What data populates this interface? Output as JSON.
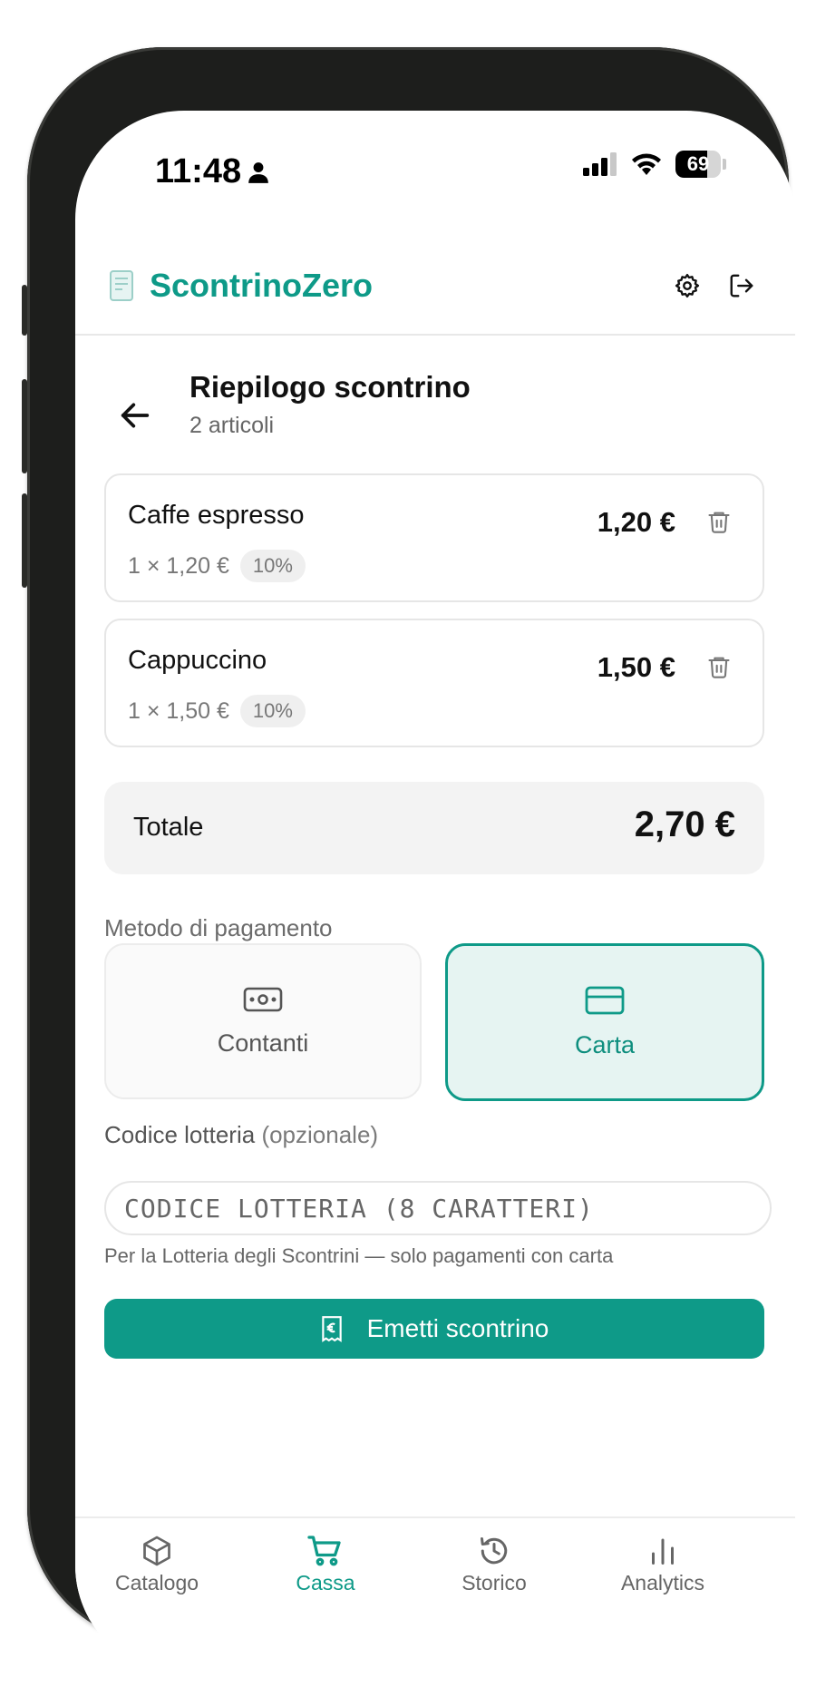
{
  "status_bar": {
    "time": "11:48",
    "battery": "69"
  },
  "header": {
    "app_name": "ScontrinoZero"
  },
  "page": {
    "title": "Riepilogo scontrino",
    "subtitle": "2 articoli"
  },
  "items": [
    {
      "name": "Caffe espresso",
      "qty_price": "1 × 1,20 €",
      "vat": "10%",
      "total": "1,20 €"
    },
    {
      "name": "Cappuccino",
      "qty_price": "1 × 1,50 €",
      "vat": "10%",
      "total": "1,50 €"
    }
  ],
  "total": {
    "label": "Totale",
    "value": "2,70 €"
  },
  "payment": {
    "label": "Metodo di pagamento",
    "options": [
      {
        "label": "Contanti",
        "selected": false
      },
      {
        "label": "Carta",
        "selected": true
      }
    ]
  },
  "lottery": {
    "label": "Codice lotteria",
    "optional": "(opzionale)",
    "placeholder": "CODICE LOTTERIA (8 CARATTERI)",
    "hint": "Per la Lotteria degli Scontrini — solo pagamenti con carta"
  },
  "emit_button": "Emetti scontrino",
  "nav": [
    {
      "label": "Catalogo",
      "icon": "box-icon",
      "active": false
    },
    {
      "label": "Cassa",
      "icon": "cart-icon",
      "active": true
    },
    {
      "label": "Storico",
      "icon": "history-icon",
      "active": false
    },
    {
      "label": "Analytics",
      "icon": "bar-chart-icon",
      "active": false
    }
  ],
  "colors": {
    "accent": "#0e9a88",
    "accent_light": "#e6f4f2"
  }
}
